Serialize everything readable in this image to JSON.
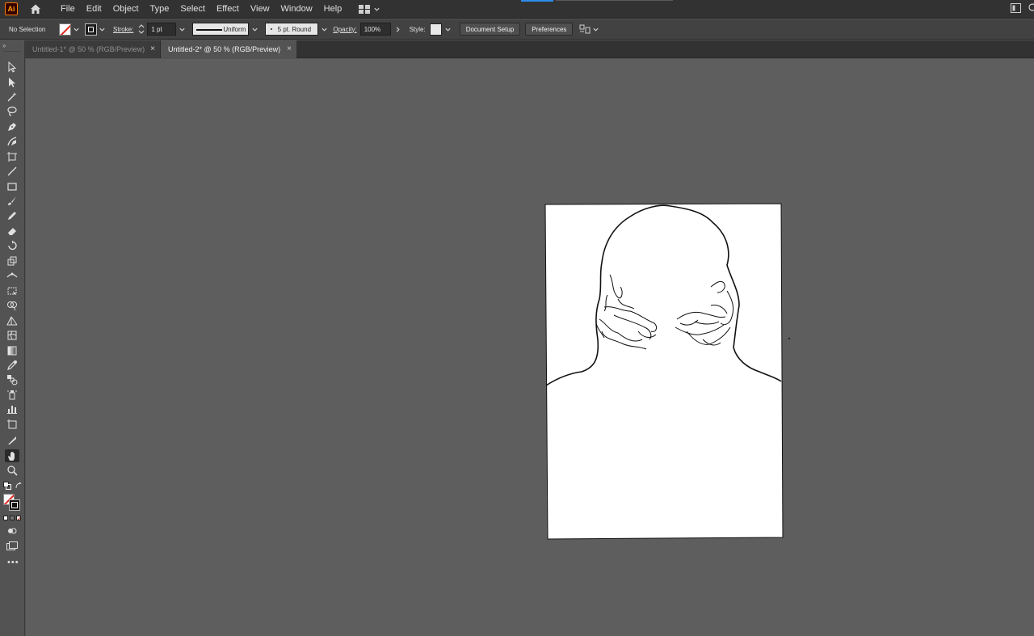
{
  "app": {
    "logo_text": "Ai",
    "accent_color": "#ff9a00"
  },
  "menu": {
    "items": [
      "File",
      "Edit",
      "Object",
      "Type",
      "Select",
      "Effect",
      "View",
      "Window",
      "Help"
    ]
  },
  "control_bar": {
    "selection_state": "No Selection",
    "stroke_label": "Stroke:",
    "stroke_weight": "1 pt",
    "stroke_profile": "Uniform",
    "brush": "5 pt. Round",
    "opacity_label": "Opacity:",
    "opacity_value": "100%",
    "style_label": "Style:",
    "document_setup": "Document Setup",
    "preferences": "Preferences"
  },
  "tabs": [
    {
      "label": "Untitled-1* @ 50 % (RGB/Preview)",
      "active": false
    },
    {
      "label": "Untitled-2* @ 50 % (RGB/Preview)",
      "active": true
    }
  ],
  "tools": [
    "selection-tool-icon",
    "direct-selection-tool-icon",
    "magic-wand-tool-icon",
    "lasso-tool-icon",
    "pen-tool-icon",
    "curvature-tool-icon",
    "artboard-tool-icon",
    "line-segment-tool-icon",
    "rectangle-tool-icon",
    "paintbrush-tool-icon",
    "pencil-tool-icon",
    "eraser-tool-icon",
    "rotate-tool-icon",
    "scale-tool-icon",
    "width-tool-icon",
    "free-transform-tool-icon",
    "shape-builder-tool-icon",
    "perspective-grid-tool-icon",
    "mesh-tool-icon",
    "gradient-tool-icon",
    "eyedropper-tool-icon",
    "blend-tool-icon",
    "symbol-sprayer-tool-icon",
    "column-graph-tool-icon",
    "slice-tool-icon",
    "knife-tool-icon",
    "hand-tool-icon",
    "zoom-tool-icon"
  ],
  "colors": {
    "canvas_bg": "#5e5e5e",
    "artboard_bg": "#ffffff",
    "stroke_none_red": "#e1251b"
  }
}
